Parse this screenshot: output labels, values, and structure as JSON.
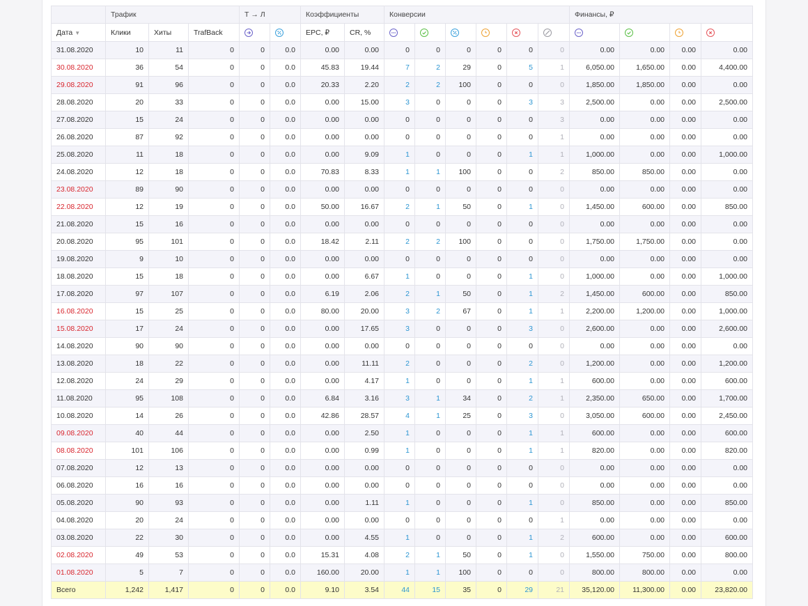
{
  "header": {
    "groups": {
      "traffic": "Трафик",
      "tl": "Т → Л",
      "coef": "Коэффициенты",
      "conversions": "Конверсии",
      "finance": "Финансы, ₽"
    },
    "cols": {
      "date": "Дата",
      "clicks": "Клики",
      "hits": "Хиты",
      "trafback": "TrafBack",
      "epc": "EPC, ₽",
      "cr": "CR, %"
    }
  },
  "rows": [
    {
      "date": "31.08.2020",
      "weekend": false,
      "clicks": "10",
      "hits": "11",
      "trafback": "0",
      "tl1": "0",
      "tl2": "0.0",
      "epc": "0.00",
      "cr": "0.00",
      "c_all": "0",
      "c_ok": "0",
      "c_pct": "0",
      "c_hold": "0",
      "c_rej": "0",
      "c_trash": "0",
      "f_all": "0.00",
      "f_ok": "0.00",
      "f_hold": "0.00",
      "f_rej": "0.00"
    },
    {
      "date": "30.08.2020",
      "weekend": true,
      "clicks": "36",
      "hits": "54",
      "trafback": "0",
      "tl1": "0",
      "tl2": "0.0",
      "epc": "45.83",
      "cr": "19.44",
      "c_all": "7",
      "c_ok": "2",
      "c_pct": "29",
      "c_hold": "0",
      "c_rej": "5",
      "c_trash": "1",
      "f_all": "6,050.00",
      "f_ok": "1,650.00",
      "f_hold": "0.00",
      "f_rej": "4,400.00"
    },
    {
      "date": "29.08.2020",
      "weekend": true,
      "clicks": "91",
      "hits": "96",
      "trafback": "0",
      "tl1": "0",
      "tl2": "0.0",
      "epc": "20.33",
      "cr": "2.20",
      "c_all": "2",
      "c_ok": "2",
      "c_pct": "100",
      "c_hold": "0",
      "c_rej": "0",
      "c_trash": "0",
      "f_all": "1,850.00",
      "f_ok": "1,850.00",
      "f_hold": "0.00",
      "f_rej": "0.00"
    },
    {
      "date": "28.08.2020",
      "weekend": false,
      "clicks": "20",
      "hits": "33",
      "trafback": "0",
      "tl1": "0",
      "tl2": "0.0",
      "epc": "0.00",
      "cr": "15.00",
      "c_all": "3",
      "c_ok": "0",
      "c_pct": "0",
      "c_hold": "0",
      "c_rej": "3",
      "c_trash": "3",
      "f_all": "2,500.00",
      "f_ok": "0.00",
      "f_hold": "0.00",
      "f_rej": "2,500.00"
    },
    {
      "date": "27.08.2020",
      "weekend": false,
      "clicks": "15",
      "hits": "24",
      "trafback": "0",
      "tl1": "0",
      "tl2": "0.0",
      "epc": "0.00",
      "cr": "0.00",
      "c_all": "0",
      "c_ok": "0",
      "c_pct": "0",
      "c_hold": "0",
      "c_rej": "0",
      "c_trash": "3",
      "f_all": "0.00",
      "f_ok": "0.00",
      "f_hold": "0.00",
      "f_rej": "0.00"
    },
    {
      "date": "26.08.2020",
      "weekend": false,
      "clicks": "87",
      "hits": "92",
      "trafback": "0",
      "tl1": "0",
      "tl2": "0.0",
      "epc": "0.00",
      "cr": "0.00",
      "c_all": "0",
      "c_ok": "0",
      "c_pct": "0",
      "c_hold": "0",
      "c_rej": "0",
      "c_trash": "1",
      "f_all": "0.00",
      "f_ok": "0.00",
      "f_hold": "0.00",
      "f_rej": "0.00"
    },
    {
      "date": "25.08.2020",
      "weekend": false,
      "clicks": "11",
      "hits": "18",
      "trafback": "0",
      "tl1": "0",
      "tl2": "0.0",
      "epc": "0.00",
      "cr": "9.09",
      "c_all": "1",
      "c_ok": "0",
      "c_pct": "0",
      "c_hold": "0",
      "c_rej": "1",
      "c_trash": "1",
      "f_all": "1,000.00",
      "f_ok": "0.00",
      "f_hold": "0.00",
      "f_rej": "1,000.00"
    },
    {
      "date": "24.08.2020",
      "weekend": false,
      "clicks": "12",
      "hits": "18",
      "trafback": "0",
      "tl1": "0",
      "tl2": "0.0",
      "epc": "70.83",
      "cr": "8.33",
      "c_all": "1",
      "c_ok": "1",
      "c_pct": "100",
      "c_hold": "0",
      "c_rej": "0",
      "c_trash": "2",
      "f_all": "850.00",
      "f_ok": "850.00",
      "f_hold": "0.00",
      "f_rej": "0.00"
    },
    {
      "date": "23.08.2020",
      "weekend": true,
      "clicks": "89",
      "hits": "90",
      "trafback": "0",
      "tl1": "0",
      "tl2": "0.0",
      "epc": "0.00",
      "cr": "0.00",
      "c_all": "0",
      "c_ok": "0",
      "c_pct": "0",
      "c_hold": "0",
      "c_rej": "0",
      "c_trash": "0",
      "f_all": "0.00",
      "f_ok": "0.00",
      "f_hold": "0.00",
      "f_rej": "0.00"
    },
    {
      "date": "22.08.2020",
      "weekend": true,
      "clicks": "12",
      "hits": "19",
      "trafback": "0",
      "tl1": "0",
      "tl2": "0.0",
      "epc": "50.00",
      "cr": "16.67",
      "c_all": "2",
      "c_ok": "1",
      "c_pct": "50",
      "c_hold": "0",
      "c_rej": "1",
      "c_trash": "0",
      "f_all": "1,450.00",
      "f_ok": "600.00",
      "f_hold": "0.00",
      "f_rej": "850.00"
    },
    {
      "date": "21.08.2020",
      "weekend": false,
      "clicks": "15",
      "hits": "16",
      "trafback": "0",
      "tl1": "0",
      "tl2": "0.0",
      "epc": "0.00",
      "cr": "0.00",
      "c_all": "0",
      "c_ok": "0",
      "c_pct": "0",
      "c_hold": "0",
      "c_rej": "0",
      "c_trash": "0",
      "f_all": "0.00",
      "f_ok": "0.00",
      "f_hold": "0.00",
      "f_rej": "0.00"
    },
    {
      "date": "20.08.2020",
      "weekend": false,
      "clicks": "95",
      "hits": "101",
      "trafback": "0",
      "tl1": "0",
      "tl2": "0.0",
      "epc": "18.42",
      "cr": "2.11",
      "c_all": "2",
      "c_ok": "2",
      "c_pct": "100",
      "c_hold": "0",
      "c_rej": "0",
      "c_trash": "0",
      "f_all": "1,750.00",
      "f_ok": "1,750.00",
      "f_hold": "0.00",
      "f_rej": "0.00"
    },
    {
      "date": "19.08.2020",
      "weekend": false,
      "clicks": "9",
      "hits": "10",
      "trafback": "0",
      "tl1": "0",
      "tl2": "0.0",
      "epc": "0.00",
      "cr": "0.00",
      "c_all": "0",
      "c_ok": "0",
      "c_pct": "0",
      "c_hold": "0",
      "c_rej": "0",
      "c_trash": "0",
      "f_all": "0.00",
      "f_ok": "0.00",
      "f_hold": "0.00",
      "f_rej": "0.00"
    },
    {
      "date": "18.08.2020",
      "weekend": false,
      "clicks": "15",
      "hits": "18",
      "trafback": "0",
      "tl1": "0",
      "tl2": "0.0",
      "epc": "0.00",
      "cr": "6.67",
      "c_all": "1",
      "c_ok": "0",
      "c_pct": "0",
      "c_hold": "0",
      "c_rej": "1",
      "c_trash": "0",
      "f_all": "1,000.00",
      "f_ok": "0.00",
      "f_hold": "0.00",
      "f_rej": "1,000.00"
    },
    {
      "date": "17.08.2020",
      "weekend": false,
      "clicks": "97",
      "hits": "107",
      "trafback": "0",
      "tl1": "0",
      "tl2": "0.0",
      "epc": "6.19",
      "cr": "2.06",
      "c_all": "2",
      "c_ok": "1",
      "c_pct": "50",
      "c_hold": "0",
      "c_rej": "1",
      "c_trash": "2",
      "f_all": "1,450.00",
      "f_ok": "600.00",
      "f_hold": "0.00",
      "f_rej": "850.00"
    },
    {
      "date": "16.08.2020",
      "weekend": true,
      "clicks": "15",
      "hits": "25",
      "trafback": "0",
      "tl1": "0",
      "tl2": "0.0",
      "epc": "80.00",
      "cr": "20.00",
      "c_all": "3",
      "c_ok": "2",
      "c_pct": "67",
      "c_hold": "0",
      "c_rej": "1",
      "c_trash": "1",
      "f_all": "2,200.00",
      "f_ok": "1,200.00",
      "f_hold": "0.00",
      "f_rej": "1,000.00"
    },
    {
      "date": "15.08.2020",
      "weekend": true,
      "clicks": "17",
      "hits": "24",
      "trafback": "0",
      "tl1": "0",
      "tl2": "0.0",
      "epc": "0.00",
      "cr": "17.65",
      "c_all": "3",
      "c_ok": "0",
      "c_pct": "0",
      "c_hold": "0",
      "c_rej": "3",
      "c_trash": "0",
      "f_all": "2,600.00",
      "f_ok": "0.00",
      "f_hold": "0.00",
      "f_rej": "2,600.00"
    },
    {
      "date": "14.08.2020",
      "weekend": false,
      "clicks": "90",
      "hits": "90",
      "trafback": "0",
      "tl1": "0",
      "tl2": "0.0",
      "epc": "0.00",
      "cr": "0.00",
      "c_all": "0",
      "c_ok": "0",
      "c_pct": "0",
      "c_hold": "0",
      "c_rej": "0",
      "c_trash": "0",
      "f_all": "0.00",
      "f_ok": "0.00",
      "f_hold": "0.00",
      "f_rej": "0.00"
    },
    {
      "date": "13.08.2020",
      "weekend": false,
      "clicks": "18",
      "hits": "22",
      "trafback": "0",
      "tl1": "0",
      "tl2": "0.0",
      "epc": "0.00",
      "cr": "11.11",
      "c_all": "2",
      "c_ok": "0",
      "c_pct": "0",
      "c_hold": "0",
      "c_rej": "2",
      "c_trash": "0",
      "f_all": "1,200.00",
      "f_ok": "0.00",
      "f_hold": "0.00",
      "f_rej": "1,200.00"
    },
    {
      "date": "12.08.2020",
      "weekend": false,
      "clicks": "24",
      "hits": "29",
      "trafback": "0",
      "tl1": "0",
      "tl2": "0.0",
      "epc": "0.00",
      "cr": "4.17",
      "c_all": "1",
      "c_ok": "0",
      "c_pct": "0",
      "c_hold": "0",
      "c_rej": "1",
      "c_trash": "1",
      "f_all": "600.00",
      "f_ok": "0.00",
      "f_hold": "0.00",
      "f_rej": "600.00"
    },
    {
      "date": "11.08.2020",
      "weekend": false,
      "clicks": "95",
      "hits": "108",
      "trafback": "0",
      "tl1": "0",
      "tl2": "0.0",
      "epc": "6.84",
      "cr": "3.16",
      "c_all": "3",
      "c_ok": "1",
      "c_pct": "34",
      "c_hold": "0",
      "c_rej": "2",
      "c_trash": "1",
      "f_all": "2,350.00",
      "f_ok": "650.00",
      "f_hold": "0.00",
      "f_rej": "1,700.00"
    },
    {
      "date": "10.08.2020",
      "weekend": false,
      "clicks": "14",
      "hits": "26",
      "trafback": "0",
      "tl1": "0",
      "tl2": "0.0",
      "epc": "42.86",
      "cr": "28.57",
      "c_all": "4",
      "c_ok": "1",
      "c_pct": "25",
      "c_hold": "0",
      "c_rej": "3",
      "c_trash": "0",
      "f_all": "3,050.00",
      "f_ok": "600.00",
      "f_hold": "0.00",
      "f_rej": "2,450.00"
    },
    {
      "date": "09.08.2020",
      "weekend": true,
      "clicks": "40",
      "hits": "44",
      "trafback": "0",
      "tl1": "0",
      "tl2": "0.0",
      "epc": "0.00",
      "cr": "2.50",
      "c_all": "1",
      "c_ok": "0",
      "c_pct": "0",
      "c_hold": "0",
      "c_rej": "1",
      "c_trash": "1",
      "f_all": "600.00",
      "f_ok": "0.00",
      "f_hold": "0.00",
      "f_rej": "600.00"
    },
    {
      "date": "08.08.2020",
      "weekend": true,
      "clicks": "101",
      "hits": "106",
      "trafback": "0",
      "tl1": "0",
      "tl2": "0.0",
      "epc": "0.00",
      "cr": "0.99",
      "c_all": "1",
      "c_ok": "0",
      "c_pct": "0",
      "c_hold": "0",
      "c_rej": "1",
      "c_trash": "1",
      "f_all": "820.00",
      "f_ok": "0.00",
      "f_hold": "0.00",
      "f_rej": "820.00"
    },
    {
      "date": "07.08.2020",
      "weekend": false,
      "clicks": "12",
      "hits": "13",
      "trafback": "0",
      "tl1": "0",
      "tl2": "0.0",
      "epc": "0.00",
      "cr": "0.00",
      "c_all": "0",
      "c_ok": "0",
      "c_pct": "0",
      "c_hold": "0",
      "c_rej": "0",
      "c_trash": "0",
      "f_all": "0.00",
      "f_ok": "0.00",
      "f_hold": "0.00",
      "f_rej": "0.00"
    },
    {
      "date": "06.08.2020",
      "weekend": false,
      "clicks": "16",
      "hits": "16",
      "trafback": "0",
      "tl1": "0",
      "tl2": "0.0",
      "epc": "0.00",
      "cr": "0.00",
      "c_all": "0",
      "c_ok": "0",
      "c_pct": "0",
      "c_hold": "0",
      "c_rej": "0",
      "c_trash": "0",
      "f_all": "0.00",
      "f_ok": "0.00",
      "f_hold": "0.00",
      "f_rej": "0.00"
    },
    {
      "date": "05.08.2020",
      "weekend": false,
      "clicks": "90",
      "hits": "93",
      "trafback": "0",
      "tl1": "0",
      "tl2": "0.0",
      "epc": "0.00",
      "cr": "1.11",
      "c_all": "1",
      "c_ok": "0",
      "c_pct": "0",
      "c_hold": "0",
      "c_rej": "1",
      "c_trash": "0",
      "f_all": "850.00",
      "f_ok": "0.00",
      "f_hold": "0.00",
      "f_rej": "850.00"
    },
    {
      "date": "04.08.2020",
      "weekend": false,
      "clicks": "20",
      "hits": "24",
      "trafback": "0",
      "tl1": "0",
      "tl2": "0.0",
      "epc": "0.00",
      "cr": "0.00",
      "c_all": "0",
      "c_ok": "0",
      "c_pct": "0",
      "c_hold": "0",
      "c_rej": "0",
      "c_trash": "1",
      "f_all": "0.00",
      "f_ok": "0.00",
      "f_hold": "0.00",
      "f_rej": "0.00"
    },
    {
      "date": "03.08.2020",
      "weekend": false,
      "clicks": "22",
      "hits": "30",
      "trafback": "0",
      "tl1": "0",
      "tl2": "0.0",
      "epc": "0.00",
      "cr": "4.55",
      "c_all": "1",
      "c_ok": "0",
      "c_pct": "0",
      "c_hold": "0",
      "c_rej": "1",
      "c_trash": "2",
      "f_all": "600.00",
      "f_ok": "0.00",
      "f_hold": "0.00",
      "f_rej": "600.00"
    },
    {
      "date": "02.08.2020",
      "weekend": true,
      "clicks": "49",
      "hits": "53",
      "trafback": "0",
      "tl1": "0",
      "tl2": "0.0",
      "epc": "15.31",
      "cr": "4.08",
      "c_all": "2",
      "c_ok": "1",
      "c_pct": "50",
      "c_hold": "0",
      "c_rej": "1",
      "c_trash": "0",
      "f_all": "1,550.00",
      "f_ok": "750.00",
      "f_hold": "0.00",
      "f_rej": "800.00"
    },
    {
      "date": "01.08.2020",
      "weekend": true,
      "clicks": "5",
      "hits": "7",
      "trafback": "0",
      "tl1": "0",
      "tl2": "0.0",
      "epc": "160.00",
      "cr": "20.00",
      "c_all": "1",
      "c_ok": "1",
      "c_pct": "100",
      "c_hold": "0",
      "c_rej": "0",
      "c_trash": "0",
      "f_all": "800.00",
      "f_ok": "800.00",
      "f_hold": "0.00",
      "f_rej": "0.00"
    }
  ],
  "total": {
    "label": "Всего",
    "clicks": "1,242",
    "hits": "1,417",
    "trafback": "0",
    "tl1": "0",
    "tl2": "0.0",
    "epc": "9.10",
    "cr": "3.54",
    "c_all": "44",
    "c_ok": "15",
    "c_pct": "35",
    "c_hold": "0",
    "c_rej": "29",
    "c_trash": "21",
    "f_all": "35,120.00",
    "f_ok": "11,300.00",
    "f_hold": "0.00",
    "f_rej": "23,820.00"
  },
  "icons": {
    "tl1": "arrow-right-circle-icon",
    "tl2": "percent-circle-icon",
    "c_all": "dots-circle-icon",
    "c_ok": "check-circle-icon",
    "c_pct": "percent-circle-icon",
    "c_hold": "clock-circle-icon",
    "c_rej": "x-circle-icon",
    "c_trash": "slash-circle-icon",
    "f_all": "dots-circle-icon",
    "f_ok": "check-circle-icon",
    "f_hold": "clock-circle-icon",
    "f_rej": "x-circle-icon"
  },
  "colors": {
    "weekend": "#d8262e",
    "link": "#2d96d2",
    "muted": "#b0b0b8",
    "total_bg": "#fdfcc9",
    "stripe": "#f4f4fa"
  }
}
